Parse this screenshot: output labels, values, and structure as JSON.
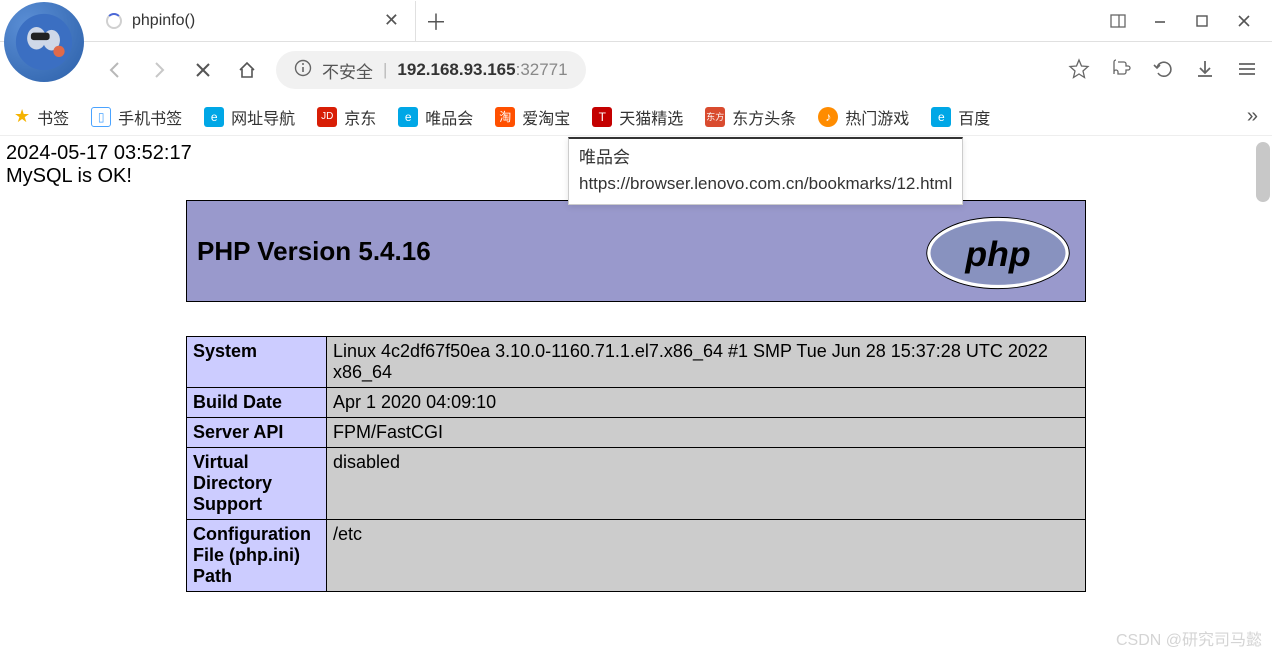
{
  "tab": {
    "title": "phpinfo()"
  },
  "address": {
    "insecure_label": "不安全",
    "host": "192.168.93.165",
    "port": ":32771"
  },
  "bookmark_bar": {
    "items": [
      {
        "label": "书签",
        "icon": "star",
        "color": "#f5b301"
      },
      {
        "label": "手机书签",
        "icon": "mobile",
        "color": "#4aa3ff"
      },
      {
        "label": "网址导航",
        "icon": "e",
        "color": "#00a7e6"
      },
      {
        "label": "京东",
        "icon": "JD",
        "color": "#d81e06"
      },
      {
        "label": "唯品会",
        "icon": "e",
        "color": "#00a7e6"
      },
      {
        "label": "爱淘宝",
        "icon": "淘",
        "color": "#ff5000"
      },
      {
        "label": "天猫精选",
        "icon": "T",
        "color": "#c40000"
      },
      {
        "label": "东方头条",
        "icon": "东方",
        "color": "#d94b2f"
      },
      {
        "label": "热门游戏",
        "icon": "●",
        "color": "#ff8c00"
      },
      {
        "label": "百度",
        "icon": "e",
        "color": "#00a7e6"
      }
    ]
  },
  "tooltip": {
    "title": "唯品会",
    "url": "https://browser.lenovo.com.cn/bookmarks/12.html"
  },
  "page": {
    "timestamp": "2024-05-17 03:52:17",
    "mysql_status": "MySQL is OK!",
    "php_version_header": "PHP Version 5.4.16",
    "rows": [
      {
        "k": "System",
        "v": "Linux 4c2df67f50ea 3.10.0-1160.71.1.el7.x86_64 #1 SMP Tue Jun 28 15:37:28 UTC 2022 x86_64"
      },
      {
        "k": "Build Date",
        "v": "Apr 1 2020 04:09:10"
      },
      {
        "k": "Server API",
        "v": "FPM/FastCGI"
      },
      {
        "k": "Virtual Directory Support",
        "v": "disabled"
      },
      {
        "k": "Configuration File (php.ini) Path",
        "v": "/etc"
      }
    ]
  },
  "watermark": "CSDN @研究司马懿"
}
